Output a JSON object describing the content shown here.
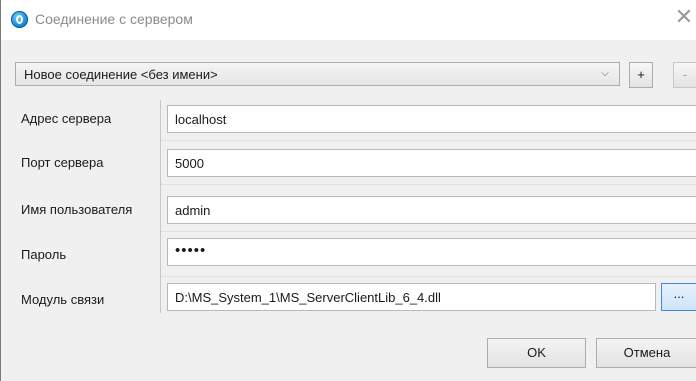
{
  "window": {
    "title": "Соединение с сервером",
    "icon": "app-connection-icon",
    "close_symbol": "✕"
  },
  "connection": {
    "selected": "Новое соединение <без имени>",
    "add_label": "+",
    "remove_label": "-"
  },
  "form": {
    "server_address": {
      "label": "Адрес сервера",
      "value": "localhost"
    },
    "server_port": {
      "label": "Порт сервера",
      "value": "5000"
    },
    "username": {
      "label": "Имя пользователя",
      "value": "admin"
    },
    "password": {
      "label": "Пароль",
      "value": "•••••"
    },
    "module": {
      "label": "Модуль связи",
      "value": "D:\\MS_System_1\\MS_ServerClientLib_6_4.dll",
      "browse_label": "..."
    }
  },
  "actions": {
    "ok_label": "OK",
    "cancel_label": "Отмена"
  },
  "colors": {
    "accent": "#3c8ad8",
    "dialog_bg": "#f0f0f0"
  }
}
